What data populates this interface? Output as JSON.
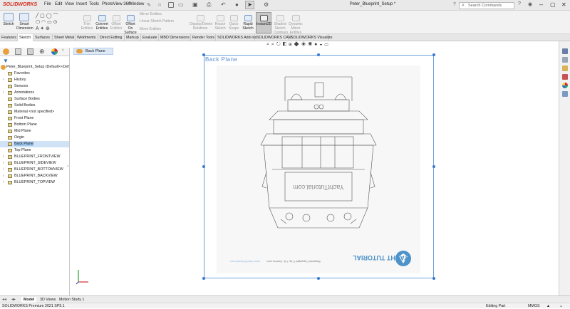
{
  "app": {
    "logo": "SOLIDWORKS",
    "menus": [
      "File",
      "Edit",
      "View",
      "Insert",
      "Tools",
      "PhotoView 360",
      "Window"
    ],
    "doc_title": "Peter_Blueprint_Setup *",
    "search_placeholder": "Search Commands"
  },
  "command_manager": {
    "tools": [
      {
        "label": "Sketch",
        "dim": false
      },
      {
        "label": "Smart Dimension",
        "dim": false
      },
      {
        "label": "Trim Entities",
        "dim": true
      },
      {
        "label": "Convert Entities",
        "dim": false
      },
      {
        "label": "Offset Entities",
        "dim": true
      },
      {
        "label": "Offset On Surface",
        "dim": false
      },
      {
        "label": "Mirror Entities",
        "dim": true
      },
      {
        "label": "Linear Sketch Pattern",
        "dim": true
      },
      {
        "label": "Move Entities",
        "dim": true
      },
      {
        "label": "Display/Delete Relations",
        "dim": true
      },
      {
        "label": "Repair Sketch",
        "dim": true
      },
      {
        "label": "Quick Snaps",
        "dim": true
      },
      {
        "label": "Rapid Sketch",
        "dim": false
      },
      {
        "label": "Instant2D",
        "dim": false
      },
      {
        "label": "Shaded Sketch Contours",
        "dim": true
      },
      {
        "label": "Dynamic Mirror Entities",
        "dim": true
      }
    ]
  },
  "tabs": [
    "Features",
    "Sketch",
    "Surfaces",
    "Sheet Metal",
    "Weldments",
    "Direct Editing",
    "Markup",
    "Evaluate",
    "MBD Dimensions",
    "Render Tools",
    "SOLIDWORKS Add-Ins",
    "SOLIDWORKS CAM",
    "SOLIDWORKS Visualize"
  ],
  "active_tab": "Sketch",
  "feature_tree": {
    "root": "Peter_Blueprint_Setup  (Default<<Defa",
    "items": [
      {
        "label": "Favorites",
        "expander": "",
        "selected": false
      },
      {
        "label": "History",
        "expander": "›",
        "selected": false
      },
      {
        "label": "Sensors",
        "expander": "",
        "selected": false
      },
      {
        "label": "Annotations",
        "expander": "›",
        "selected": false
      },
      {
        "label": "Surface Bodies",
        "expander": "",
        "selected": false
      },
      {
        "label": "Solid Bodies",
        "expander": "",
        "selected": false
      },
      {
        "label": "Material <not specified>",
        "expander": "",
        "selected": false
      },
      {
        "label": "Front Plane",
        "expander": "",
        "selected": false
      },
      {
        "label": "Bottom Plane",
        "expander": "",
        "selected": false
      },
      {
        "label": "Mid Plane",
        "expander": "",
        "selected": false
      },
      {
        "label": "Origin",
        "expander": "",
        "selected": false
      },
      {
        "label": "Back Plane",
        "expander": "",
        "selected": true
      },
      {
        "label": "Top Plane",
        "expander": "",
        "selected": false
      },
      {
        "label": "BLUEPRINT_FRONTVIEW",
        "expander": "›",
        "selected": false
      },
      {
        "label": "BLUEPRINT_SIDEVIEW",
        "expander": "›",
        "selected": false
      },
      {
        "label": "BLUEPRINT_BOTTOMVIEW",
        "expander": "›",
        "selected": false
      },
      {
        "label": "BLUEPRINT_BACKVIEW",
        "expander": "›",
        "selected": false
      },
      {
        "label": "BLUEPRINT_TOPVIEW",
        "expander": "›",
        "selected": false
      }
    ]
  },
  "viewport": {
    "breadcrumb": "Back Plane",
    "plane_label": "Back Plane",
    "blueprint_watermark": "YachtTutorial.com",
    "blueprint_copyright": "Blueprint Copyright © by J.W. Zweers.com",
    "blueprint_site": "www.YachtTutorial.com",
    "blueprint_logo": "YACHT TUTORIAL"
  },
  "bottom_tabs": [
    "Model",
    "3D Views",
    "Motion Study 1"
  ],
  "status": {
    "left": "SOLIDWORKS Premium 2021 SP5.1",
    "mode": "Editing Part",
    "units": "MMGS"
  },
  "colors": {
    "accent": "#3a78c9",
    "brand": "#d52b1e",
    "plane": "#6aa0dc"
  }
}
